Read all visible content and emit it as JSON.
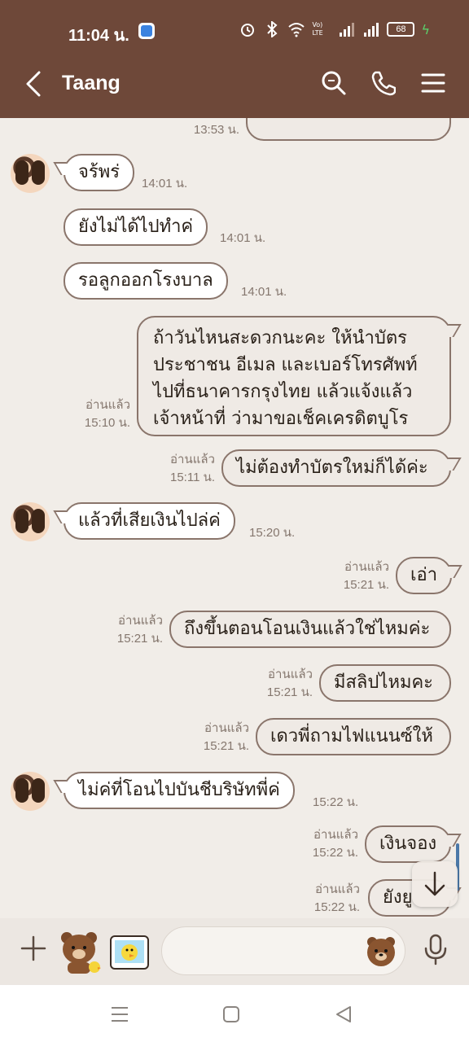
{
  "status_bar": {
    "time": "11:04 น.",
    "battery": "68",
    "network": "Vo) LTE"
  },
  "header": {
    "title": "Taang"
  },
  "messages": [
    {
      "side": "me",
      "text": "",
      "time": "13:53 น.",
      "read": ""
    },
    {
      "side": "them",
      "text": "จร้พร่",
      "time": "14:01 น."
    },
    {
      "side": "them",
      "text": "ยังไม่ได้ไปทำค่",
      "time": "14:01 น."
    },
    {
      "side": "them",
      "text": "รอลูกออกโรงบาล",
      "time": "14:01 น."
    },
    {
      "side": "me",
      "text": "ถ้าวันไหนสะดวกนะคะ ให้นำบัตรประชาชน อีเมล และเบอร์โทรศัพท์ไปที่ธนาคารกรุงไทย แล้วแจ้งแล้วเจ้าหน้าที่ ว่ามาขอเช็คเครดิตบูโร",
      "time": "15:10 น.",
      "read": "อ่านแล้ว"
    },
    {
      "side": "me",
      "text": "ไม่ต้องทำบัตรใหม่ก็ได้ค่ะ",
      "time": "15:11 น.",
      "read": "อ่านแล้ว"
    },
    {
      "side": "them",
      "text": "แล้วที่เสียเงินไปล่ค่",
      "time": "15:20 น."
    },
    {
      "side": "me",
      "text": "เอ่า",
      "time": "15:21 น.",
      "read": "อ่านแล้ว"
    },
    {
      "side": "me",
      "text": "ถึงขึ้นตอนโอนเงินแล้วใช่ไหมค่ะ",
      "time": "15:21 น.",
      "read": "อ่านแล้ว"
    },
    {
      "side": "me",
      "text": "มีสลิปไหมคะ",
      "time": "15:21 น.",
      "read": "อ่านแล้ว"
    },
    {
      "side": "me",
      "text": "เดวพี่ถามไฟแนนซ์ให้",
      "time": "15:21 น.",
      "read": "อ่านแล้ว"
    },
    {
      "side": "them",
      "text": "ไม่ค่ที่โอนไปบันชีบริษัทพี่ค่",
      "time": "15:22 น."
    },
    {
      "side": "me",
      "text": "เงินจอง",
      "time": "15:22 น.",
      "read": "อ่านแล้ว"
    },
    {
      "side": "me",
      "text": "ยังยู",
      "time": "15:22 น.",
      "read": "อ่านแล้ว"
    }
  ],
  "input": {
    "placeholder": ""
  }
}
